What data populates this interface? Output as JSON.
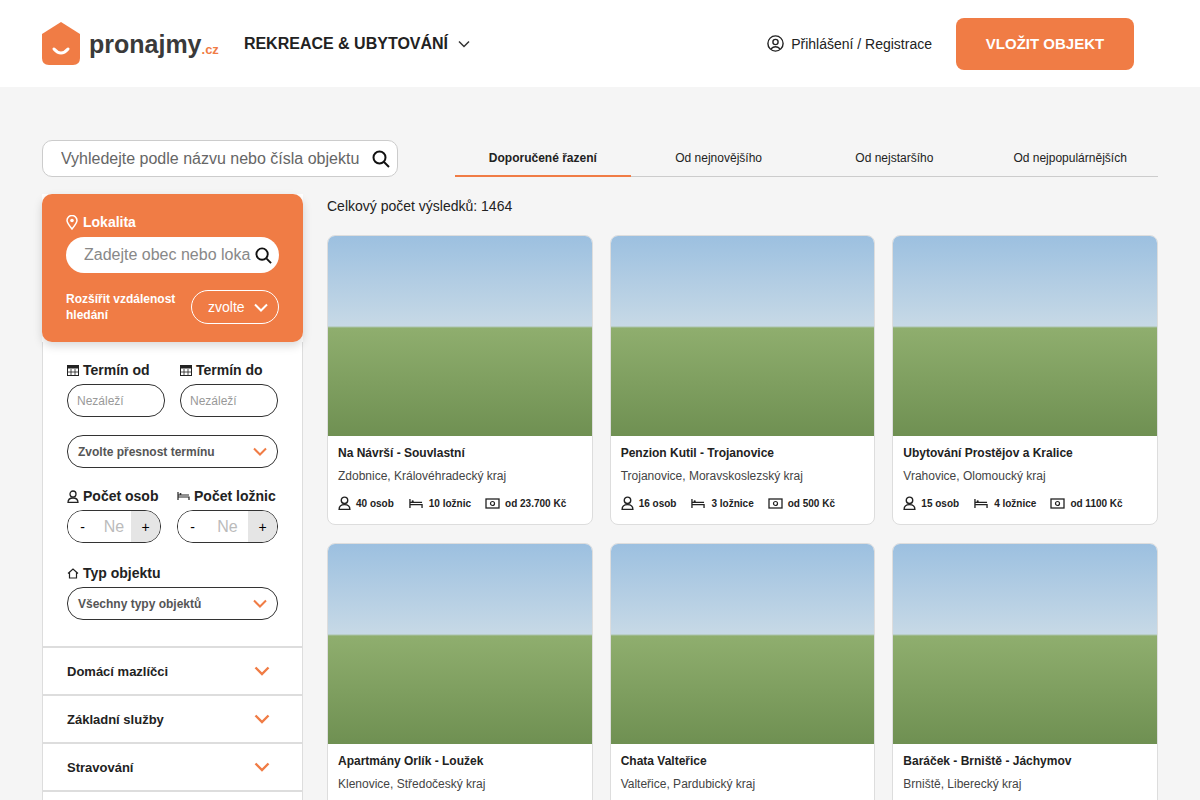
{
  "header": {
    "logo_text": "pronajmy",
    "logo_suffix": ".cz",
    "nav": "REKREACE & UBYTOVÁNÍ",
    "login": "Přihlášení / Registrace",
    "cta": "VLOŽIT OBJEKT"
  },
  "search": {
    "placeholder": "Vyhledejte podle názvu nebo čísla objektu"
  },
  "location_filter": {
    "label": "Lokalita",
    "placeholder": "Zadejte obec nebo loka",
    "distance_label": "Rozšířit vzdálenost hledání",
    "distance_value": "zvolte"
  },
  "filters": {
    "date_from": {
      "label": "Termín od",
      "placeholder": "Nezáleží"
    },
    "date_to": {
      "label": "Termín do",
      "placeholder": "Nezáleží"
    },
    "precision": "Zvolte přesnost termínu",
    "steppers": [
      {
        "label": "Počet osob",
        "kind": "persons",
        "minus": "-",
        "placeholder": "Ne",
        "plus": "+"
      },
      {
        "label": "Počet ložnic",
        "kind": "bedrooms",
        "minus": "-",
        "placeholder": "Ne",
        "plus": "+"
      }
    ],
    "type": {
      "label": "Typ objektu",
      "value": "Všechny typy objektů"
    }
  },
  "accordions": [
    {
      "label": "Domácí mazlíčci",
      "expanded": false
    },
    {
      "label": "Základní služby",
      "expanded": false
    },
    {
      "label": "Stravování",
      "expanded": false
    }
  ],
  "sort_tabs": [
    {
      "label": "Doporučené řazení",
      "selected": true
    },
    {
      "label": "Od nejnovějšího",
      "selected": false
    },
    {
      "label": "Od nejstaršího",
      "selected": false
    },
    {
      "label": "Od nejpopulárnějších",
      "selected": false
    }
  ],
  "results": {
    "count_text": "Celkový počet výsledků: 1464"
  },
  "listings": [
    {
      "title": "Na Návrší - Souvlastní",
      "location": "Zdobnice, Královéhradecký kraj",
      "persons": "40 osob",
      "bedrooms": "10 ložnic",
      "price": "od 23.700 Kč"
    },
    {
      "title": "Penzion Kutil - Trojanovice",
      "location": "Trojanovice, Moravskoslezský kraj",
      "persons": "16 osob",
      "bedrooms": "3 ložnice",
      "price": "od 500 Kč"
    },
    {
      "title": "Ubytování Prostějov a Kralice",
      "location": "Vrahovice, Olomoucký kraj",
      "persons": "15 osob",
      "bedrooms": "4 ložnice",
      "price": "od 1100 Kč"
    },
    {
      "title": "Apartmány Orlík - Loužek",
      "location": "Klenovice, Středočeský kraj"
    },
    {
      "title": "Chata Valteřice",
      "location": "Valteřice, Pardubický kraj"
    },
    {
      "title": "Baráček - Brniště - Jáchymov",
      "location": "Brniště, Liberecký kraj"
    }
  ]
}
